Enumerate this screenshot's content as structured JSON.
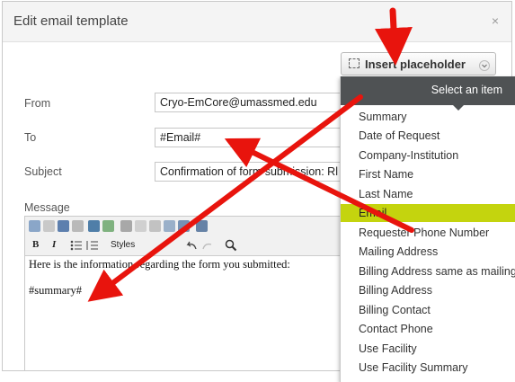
{
  "dialog": {
    "title": "Edit email template",
    "close_label": "×"
  },
  "placeholder_button": {
    "label": "Insert placeholder"
  },
  "form": {
    "from_label": "From",
    "from_value": "Cryo-EmCore@umassmed.edu",
    "to_label": "To",
    "to_value": "#Email#",
    "subject_label": "Subject",
    "subject_value": "Confirmation of form submission: Rl",
    "message_label": "Message"
  },
  "editor": {
    "styles_label": "Styles",
    "bold_label": "B",
    "italic_label": "I",
    "line1": "Here is the information regarding the form you submitted:",
    "line2": "#summary#"
  },
  "dropdown": {
    "header": "Select an item",
    "items": [
      "Summary",
      "Date of Request",
      "Company-Institution",
      "First Name",
      "Last Name",
      "Email",
      "Requester Phone Number",
      "Mailing Address",
      "Billing Address same as mailing",
      "Billing Address",
      "Billing Contact",
      "Contact Phone",
      "Use Facility",
      "Use Facility Summary"
    ],
    "selected_item": "Email"
  },
  "colors": {
    "highlight": "#c4d40e",
    "arrow": "#e8140d",
    "dropdown_header": "#4f5254"
  }
}
